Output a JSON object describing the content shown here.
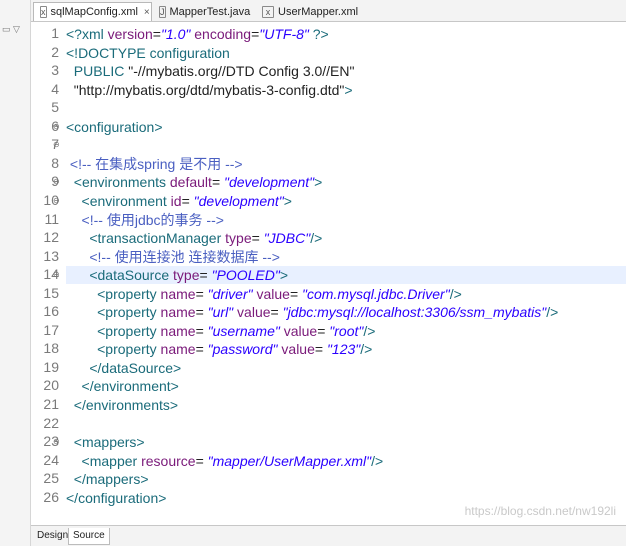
{
  "tabs": [
    {
      "label": "sqlMapConfig.xml",
      "active": true
    },
    {
      "label": "MapperTest.java",
      "active": false
    },
    {
      "label": "UserMapper.xml",
      "active": false
    }
  ],
  "lines": [
    {
      "n": "1",
      "segments": [
        [
          "pi",
          "<?xml "
        ],
        [
          "attr",
          "version"
        ],
        [
          "txt",
          "="
        ],
        [
          "val",
          "\"1.0\""
        ],
        [
          "txt",
          " "
        ],
        [
          "attr",
          "encoding"
        ],
        [
          "txt",
          "="
        ],
        [
          "val",
          "\"UTF-8\""
        ],
        [
          "pi",
          " ?>"
        ]
      ]
    },
    {
      "n": "2",
      "segments": [
        [
          "tag",
          "<!DOCTYPE configuration"
        ]
      ]
    },
    {
      "n": "3",
      "segments": [
        [
          "tag",
          "  PUBLIC "
        ],
        [
          "txt",
          "\"-//mybatis.org//DTD Config 3.0//EN\""
        ]
      ]
    },
    {
      "n": "4",
      "segments": [
        [
          "txt",
          "  \"http://mybatis.org/dtd/mybatis-3-config.dtd\""
        ],
        [
          "tag",
          ">"
        ]
      ]
    },
    {
      "n": "5",
      "segments": []
    },
    {
      "n": "6",
      "segments": [
        [
          "tag",
          "<configuration>"
        ]
      ],
      "fold": true
    },
    {
      "n": "7",
      "segments": [],
      "fold": true
    },
    {
      "n": "8",
      "segments": [
        [
          "cmt",
          " <!-- 在集成spring 是不用 -->"
        ]
      ]
    },
    {
      "n": "9",
      "segments": [
        [
          "tag",
          "  <environments "
        ],
        [
          "attr",
          "default"
        ],
        [
          "txt",
          "= "
        ],
        [
          "val",
          "\"development\""
        ],
        [
          "tag",
          ">"
        ]
      ],
      "fold": true
    },
    {
      "n": "10",
      "segments": [
        [
          "tag",
          "    <environment "
        ],
        [
          "attr",
          "id"
        ],
        [
          "txt",
          "= "
        ],
        [
          "val",
          "\"development\""
        ],
        [
          "tag",
          ">"
        ]
      ],
      "fold": true
    },
    {
      "n": "11",
      "segments": [
        [
          "cmt",
          "    <!-- 使用jdbc的事务 -->"
        ]
      ]
    },
    {
      "n": "12",
      "segments": [
        [
          "tag",
          "      <transactionManager "
        ],
        [
          "attr",
          "type"
        ],
        [
          "txt",
          "= "
        ],
        [
          "val",
          "\"JDBC\""
        ],
        [
          "tag",
          "/>"
        ]
      ]
    },
    {
      "n": "13",
      "segments": [
        [
          "cmt",
          "      <!-- 使用连接池 连接数据库 -->"
        ]
      ]
    },
    {
      "n": "14",
      "segments": [
        [
          "tag",
          "      <dataSource "
        ],
        [
          "attr",
          "type"
        ],
        [
          "txt",
          "= "
        ],
        [
          "val",
          "\"POOLED\""
        ],
        [
          "tag",
          ">"
        ]
      ],
      "fold": true,
      "highlight": true
    },
    {
      "n": "15",
      "segments": [
        [
          "tag",
          "        <property "
        ],
        [
          "attr",
          "name"
        ],
        [
          "txt",
          "= "
        ],
        [
          "val",
          "\"driver\""
        ],
        [
          "txt",
          " "
        ],
        [
          "attr",
          "value"
        ],
        [
          "txt",
          "= "
        ],
        [
          "val",
          "\"com.mysql.jdbc.Driver\""
        ],
        [
          "tag",
          "/>"
        ]
      ]
    },
    {
      "n": "16",
      "segments": [
        [
          "tag",
          "        <property "
        ],
        [
          "attr",
          "name"
        ],
        [
          "txt",
          "= "
        ],
        [
          "val",
          "\"url\""
        ],
        [
          "txt",
          " "
        ],
        [
          "attr",
          "value"
        ],
        [
          "txt",
          "= "
        ],
        [
          "val",
          "\"jdbc:mysql://localhost:3306/ssm_mybatis\""
        ],
        [
          "tag",
          "/>"
        ]
      ]
    },
    {
      "n": "17",
      "segments": [
        [
          "tag",
          "        <property "
        ],
        [
          "attr",
          "name"
        ],
        [
          "txt",
          "= "
        ],
        [
          "val",
          "\"username\""
        ],
        [
          "txt",
          " "
        ],
        [
          "attr",
          "value"
        ],
        [
          "txt",
          "= "
        ],
        [
          "val",
          "\"root\""
        ],
        [
          "tag",
          "/>"
        ]
      ]
    },
    {
      "n": "18",
      "segments": [
        [
          "tag",
          "        <property "
        ],
        [
          "attr",
          "name"
        ],
        [
          "txt",
          "= "
        ],
        [
          "val",
          "\"password\""
        ],
        [
          "txt",
          " "
        ],
        [
          "attr",
          "value"
        ],
        [
          "txt",
          "= "
        ],
        [
          "val",
          "\"123\""
        ],
        [
          "tag",
          "/>"
        ]
      ]
    },
    {
      "n": "19",
      "segments": [
        [
          "tag",
          "      </dataSource>"
        ]
      ]
    },
    {
      "n": "20",
      "segments": [
        [
          "tag",
          "    </environment>"
        ]
      ]
    },
    {
      "n": "21",
      "segments": [
        [
          "tag",
          "  </environments>"
        ]
      ]
    },
    {
      "n": "22",
      "segments": []
    },
    {
      "n": "23",
      "segments": [
        [
          "tag",
          "  <mappers>"
        ]
      ],
      "fold": true
    },
    {
      "n": "24",
      "segments": [
        [
          "tag",
          "    <mapper "
        ],
        [
          "attr",
          "resource"
        ],
        [
          "txt",
          "= "
        ],
        [
          "val",
          "\"mapper/UserMapper.xml\""
        ],
        [
          "tag",
          "/>"
        ]
      ]
    },
    {
      "n": "25",
      "segments": [
        [
          "tag",
          "  </mappers>"
        ]
      ]
    },
    {
      "n": "26",
      "segments": [
        [
          "tag",
          "</configuration>"
        ]
      ]
    }
  ],
  "bottom_tabs": [
    {
      "label": "Design",
      "active": false
    },
    {
      "label": "Source",
      "active": true
    }
  ],
  "watermark": "https://blog.csdn.net/nw192li"
}
